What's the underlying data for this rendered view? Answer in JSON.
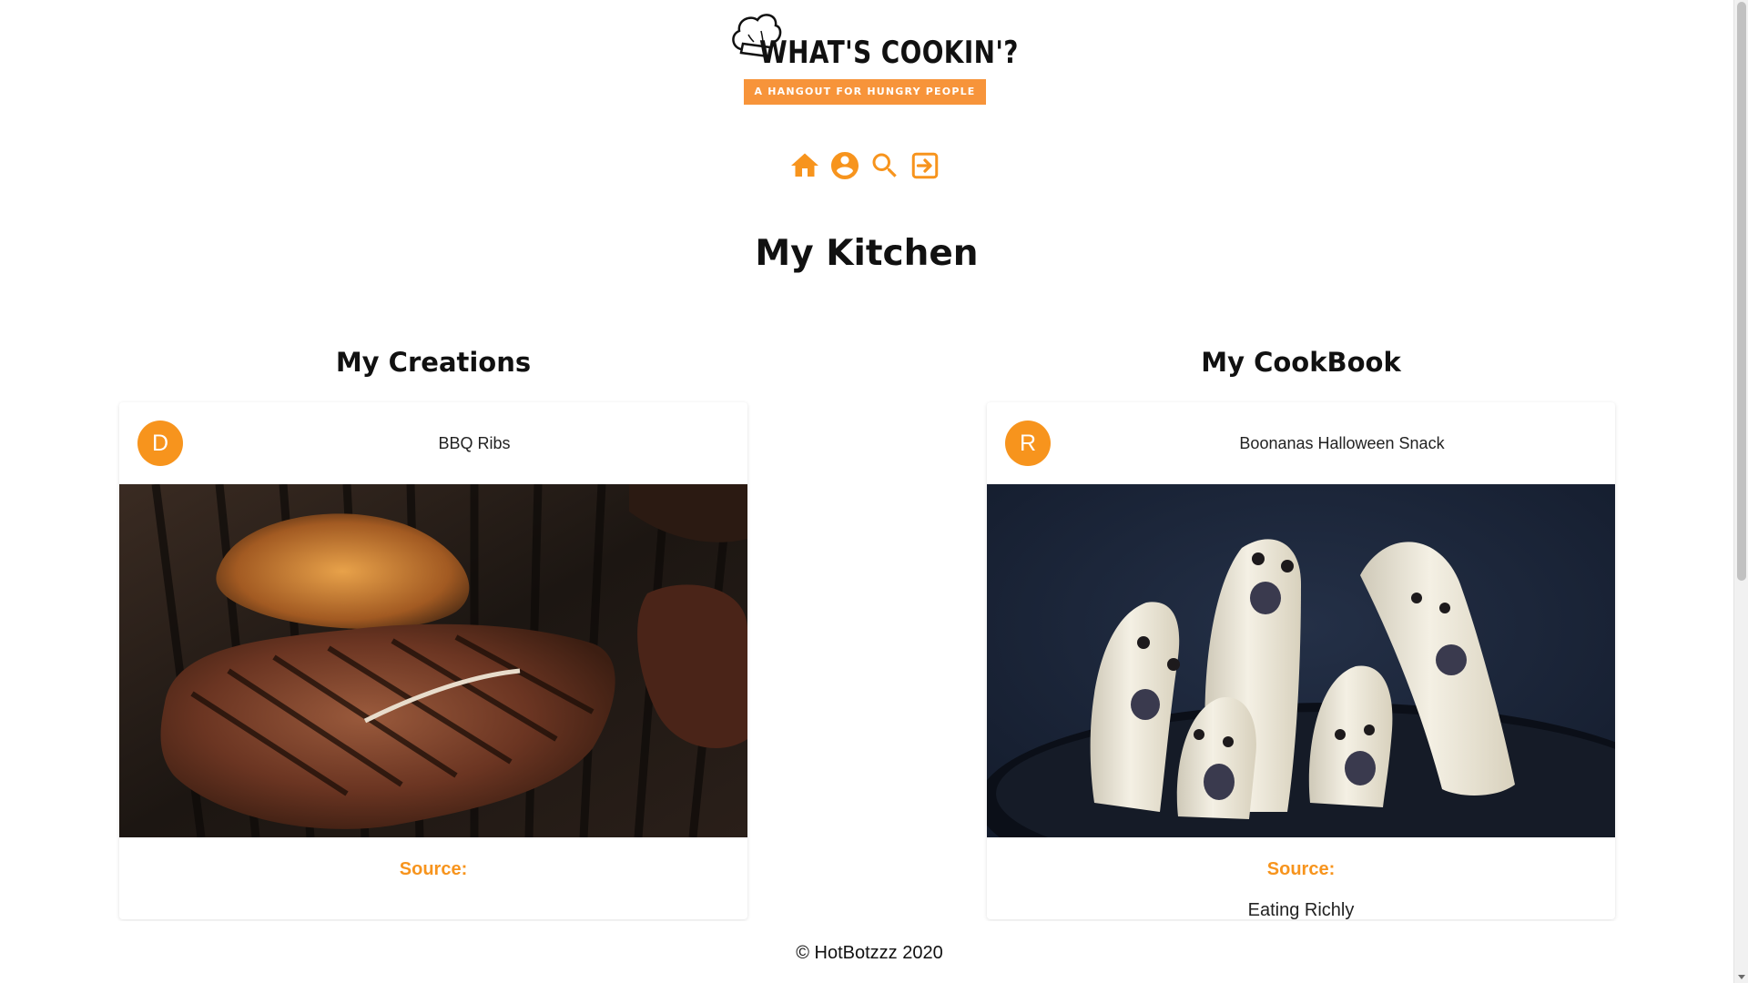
{
  "brand": {
    "name": "WHAT'S COOKIN'?",
    "tagline": "A HANGOUT FOR HUNGRY PEOPLE",
    "accent_color": "#f7941d"
  },
  "nav": {
    "items": [
      {
        "icon": "home-icon",
        "label": "Home"
      },
      {
        "icon": "account-icon",
        "label": "Profile"
      },
      {
        "icon": "search-icon",
        "label": "Search"
      },
      {
        "icon": "logout-icon",
        "label": "Log out"
      }
    ]
  },
  "page_title": "My Kitchen",
  "sections": {
    "creations": {
      "heading": "My Creations",
      "card": {
        "avatar_letter": "D",
        "title": "BBQ Ribs",
        "image": "grilled-steak-photo",
        "source_label": "Source:",
        "source_value": ""
      }
    },
    "cookbook": {
      "heading": "My CookBook",
      "card": {
        "avatar_letter": "R",
        "title": "Boonanas Halloween Snack",
        "image": "banana-ghosts-photo",
        "source_label": "Source:",
        "source_value": "Eating Richly"
      }
    }
  },
  "footer": {
    "text": "© HotBotzzz 2020"
  }
}
